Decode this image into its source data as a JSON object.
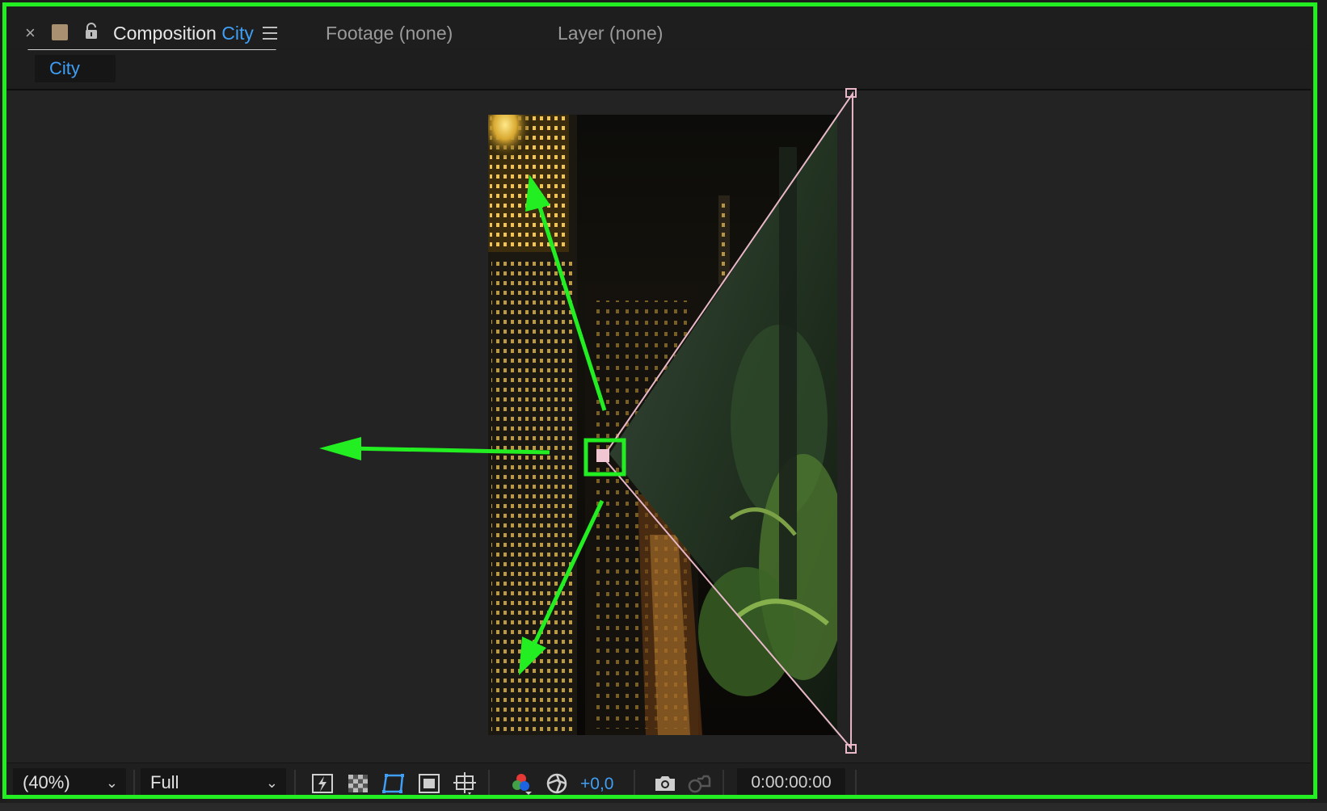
{
  "tabs": {
    "active": {
      "prefix": "Composition",
      "name": "City"
    },
    "footage_label": "Footage (none)",
    "layer_label": "Layer (none)"
  },
  "subtab": {
    "label": "City"
  },
  "toolbar": {
    "zoom": "(40%)",
    "resolution": "Full",
    "exposure": "+0,0",
    "timecode": "0:00:00:00"
  },
  "colors": {
    "accent": "#3f9ff5",
    "annotation": "#22ee22",
    "layer_outline": "#e8b8c8",
    "swatch": "#a89070"
  },
  "icons": [
    "close-icon",
    "label-color-swatch",
    "lock-icon",
    "panel-menu-icon",
    "chevron-down-icon",
    "fast-previews-icon",
    "transparency-grid-icon",
    "region-of-interest-icon",
    "mask-visibility-icon",
    "guides-icon",
    "show-channel-icon",
    "color-management-icon",
    "snapshot-icon",
    "show-snapshot-icon"
  ]
}
